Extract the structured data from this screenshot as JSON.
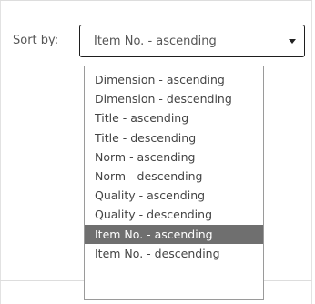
{
  "sort": {
    "label": "Sort by:",
    "selected": "Item No. - ascending",
    "options": [
      "Dimension - ascending",
      "Dimension - descending",
      "Title - ascending",
      "Title - descending",
      "Norm - ascending",
      "Norm - descending",
      "Quality - ascending",
      "Quality - descending",
      "Item No. - ascending",
      "Item No. - descending"
    ],
    "highlighted_index": 8
  },
  "colors": {
    "highlight": "#6f6f6f",
    "border": "#1e1e1e",
    "text": "#444444"
  },
  "icons": {
    "dropdown_caret": "chevron-down-icon"
  }
}
